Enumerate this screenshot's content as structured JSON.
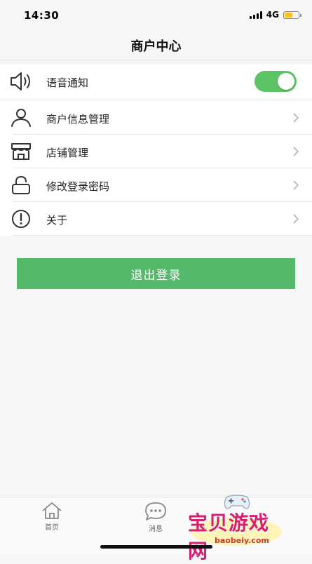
{
  "status_bar": {
    "time": "14:30",
    "network": "4G",
    "battery_level": 0.6,
    "battery_color": "#f5c22a"
  },
  "nav": {
    "title": "商户中心"
  },
  "menu": {
    "voice_notification": {
      "label": "语音通知",
      "icon": "speaker-icon",
      "toggle_on": true,
      "toggle_color": "#5cc464"
    },
    "items": [
      {
        "label": "商户信息管理",
        "icon": "user-icon"
      },
      {
        "label": "店铺管理",
        "icon": "store-icon"
      },
      {
        "label": "修改登录密码",
        "icon": "lock-icon"
      },
      {
        "label": "关于",
        "icon": "info-icon"
      }
    ]
  },
  "logout": {
    "label": "退出登录",
    "color": "#55b96b"
  },
  "tab_bar": {
    "tabs": [
      {
        "label": "首页",
        "icon": "home-icon"
      },
      {
        "label": "消息",
        "icon": "chat-icon"
      }
    ]
  },
  "watermark": {
    "text": "宝贝游戏网",
    "url": "baobeiy.com"
  }
}
